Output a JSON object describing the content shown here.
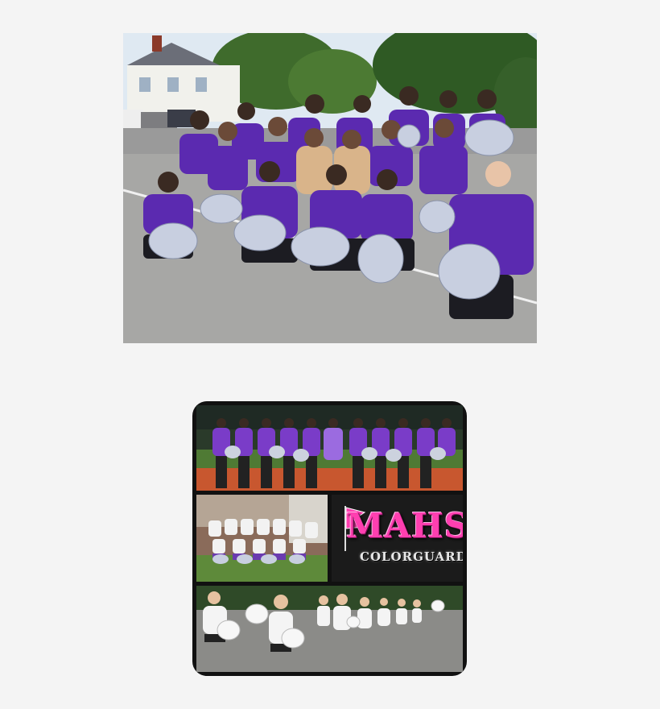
{
  "photo_top": {
    "subject": "cheer-squad-group",
    "colors": {
      "shirt": "#5b2ab0",
      "pompom": "#c8cfe0",
      "grass": "#4d7a2e",
      "sky": "#dfe9f2",
      "road": "#9a9a9a"
    }
  },
  "collage": {
    "logo_main": "MAHS",
    "logo_sub": "COLORGUARD",
    "colors": {
      "logo_pink": "#ff3fb0",
      "track": "#c8572f",
      "purple": "#7a3cc8"
    }
  }
}
